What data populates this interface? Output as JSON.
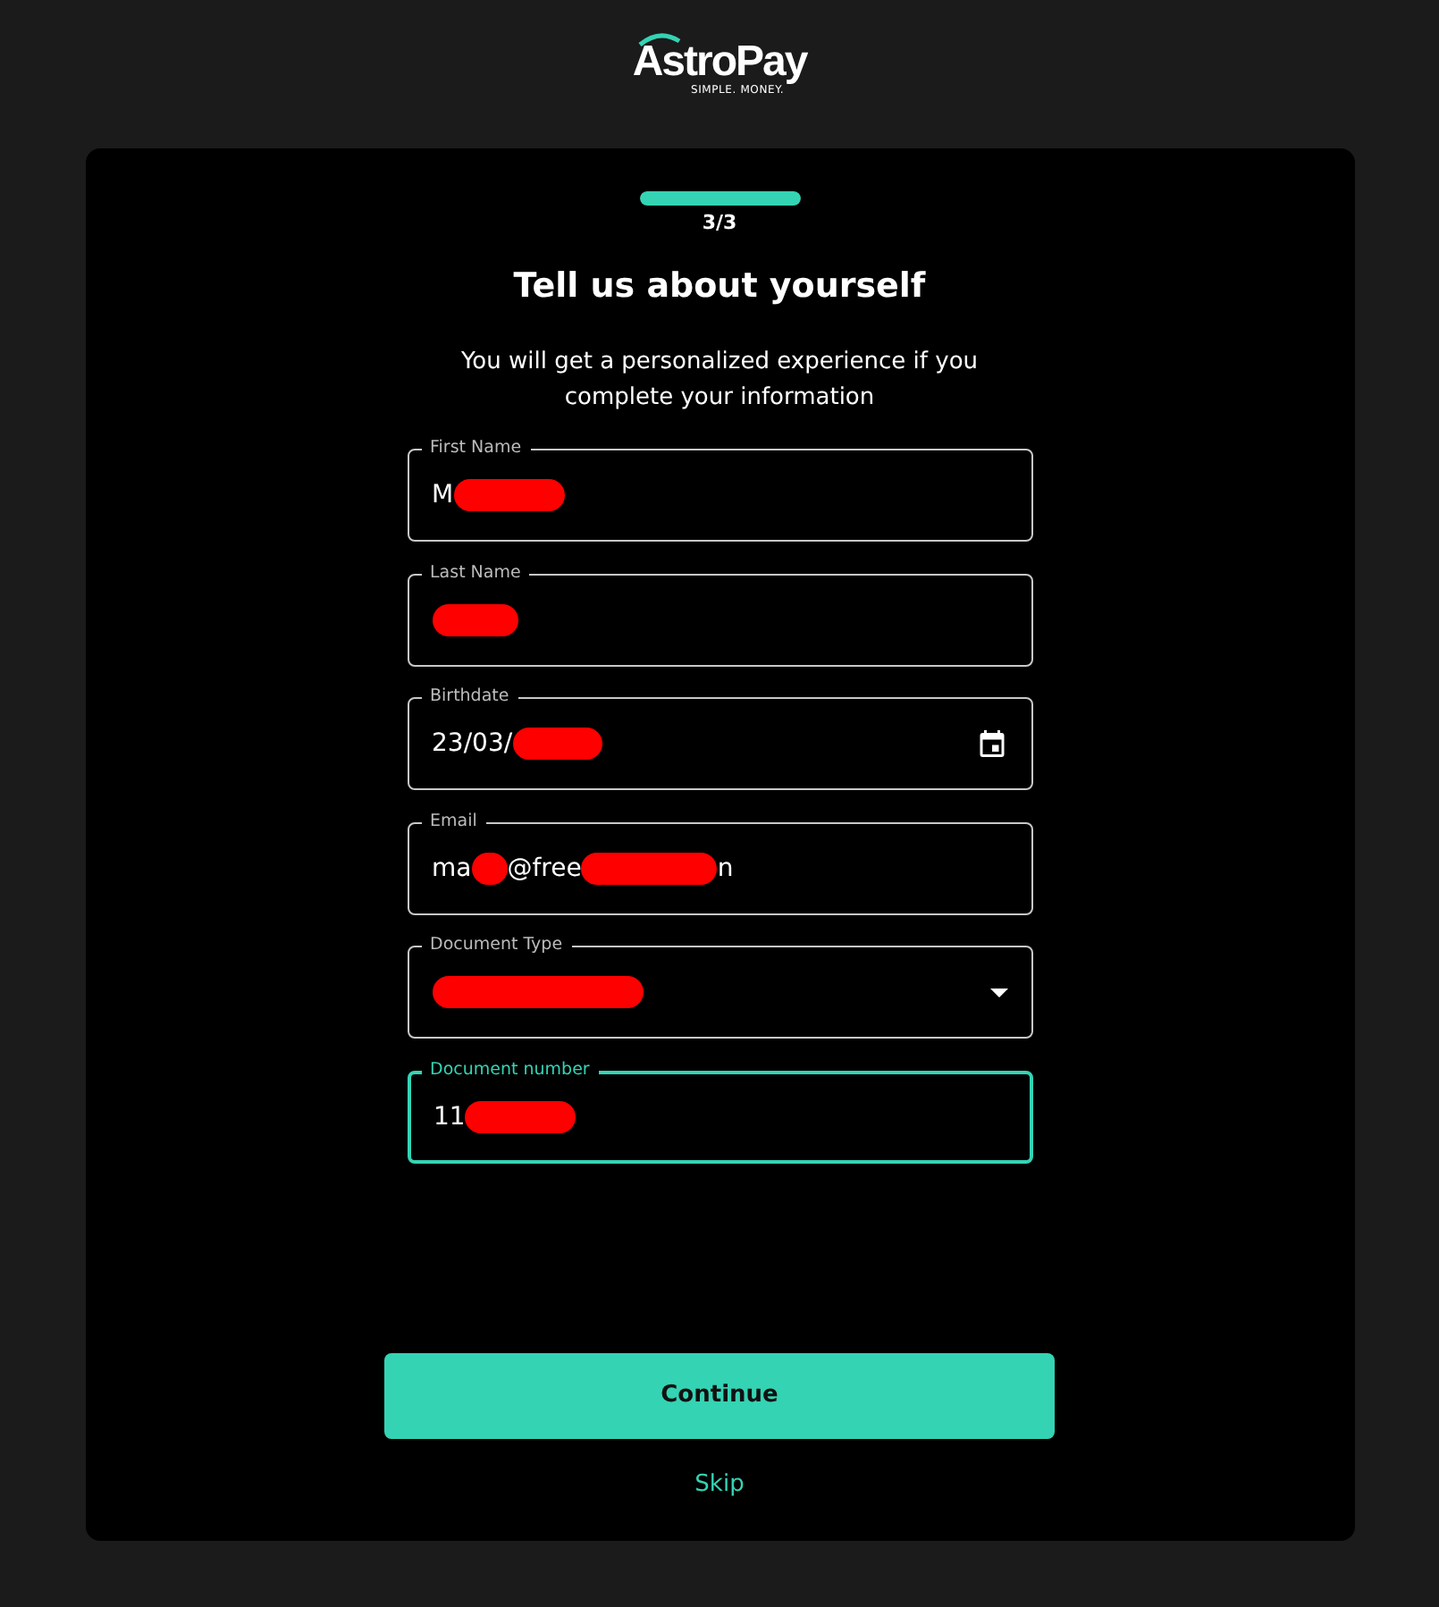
{
  "logo": {
    "name": "AstroPay",
    "tagline": "SIMPLE. MONEY."
  },
  "progress": {
    "level": 1,
    "step": "3/3"
  },
  "title": "Tell us about yourself",
  "subtitle": "You will get a personalized experience if you complete your information",
  "fields": [
    {
      "label": "First Name",
      "kind": "text",
      "value_parts": [
        "M"
      ],
      "redacted_end": true,
      "focused": false
    },
    {
      "label": "Last Name",
      "kind": "text",
      "redacted_end": true,
      "focused": false
    },
    {
      "label": "Birthdate",
      "kind": "date",
      "value_parts": [
        "23/03/"
      ],
      "redacted_end": true,
      "focused": false
    },
    {
      "label": "Email",
      "kind": "text",
      "value_parts": [
        "ma",
        "@free",
        "n"
      ],
      "redacted_end": false,
      "focused": false
    },
    {
      "label": "Document Type",
      "kind": "select",
      "redacted_end": true,
      "focused": false
    },
    {
      "label": "Document number",
      "kind": "text",
      "value_parts": [
        "11"
      ],
      "redacted_end": true,
      "focused": true
    }
  ],
  "primary_button": "Continue",
  "skip_link": "Skip"
}
